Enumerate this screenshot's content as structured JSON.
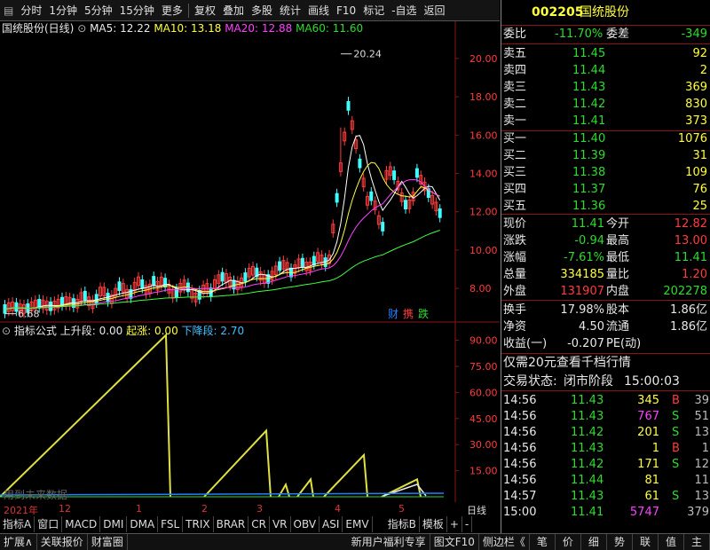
{
  "toolbar": {
    "left_items": [
      "分时",
      "1分钟",
      "5分钟",
      "15分钟",
      "更多"
    ],
    "right_items": [
      "复权",
      "叠加",
      "多股",
      "统计",
      "画线",
      "F10",
      "标记",
      "-自选",
      "返回"
    ]
  },
  "kline": {
    "title": "国统股份(日线)",
    "ma5": "MA5: 12.22",
    "ma10": "MA10: 13.18",
    "ma20": "MA20: 12.88",
    "ma60": "MA60: 11.60",
    "high_label": "20.24",
    "low_label": "6.68",
    "badges": [
      "财",
      "携",
      "跌"
    ],
    "y_ticks": [
      "20.00",
      "18.00",
      "16.00",
      "14.00",
      "12.00",
      "10.00",
      "8.00"
    ],
    "colors": {
      "ma5": "#ffffff",
      "ma10": "#ffff40",
      "ma20": "#ff40ff",
      "ma60": "#40ff40",
      "up": "#ff3c3c",
      "down": "#40ffff"
    }
  },
  "indicator": {
    "title": "指标公式",
    "up_label": "上升段: 0.00",
    "rise_label": "起涨: 0.00",
    "down_label": "下降段: 2.70",
    "future_note": "用到未来数据",
    "y_ticks": [
      "90.00",
      "75.00",
      "60.00",
      "45.00",
      "30.00",
      "15.00"
    ]
  },
  "timeline": {
    "year": "2021年",
    "months": [
      "12",
      "1",
      "2",
      "3",
      "4",
      "5"
    ],
    "right": "日线"
  },
  "tabs": [
    "指标A",
    "窗口",
    "MACD",
    "DMI",
    "DMA",
    "FSL",
    "TRIX",
    "BRAR",
    "CR",
    "VR",
    "OBV",
    "ASI",
    "EMV",
    "指标B",
    "模板",
    "+",
    "-"
  ],
  "bottom_bar": {
    "left": [
      "扩展∧",
      "关联报价",
      "财富圈"
    ],
    "middle": [
      "新用户福利专享",
      "图文F10",
      "侧边栏《"
    ],
    "right": [
      "笔",
      "价",
      "细",
      "势",
      "联",
      "值",
      "主"
    ]
  },
  "quote": {
    "code": "002205",
    "name": "国统股份",
    "weibi_label": "委比",
    "weibi": "-11.70%",
    "weicha_label": "委差",
    "weicha": "-349",
    "asks": [
      {
        "label": "卖五",
        "price": "11.45",
        "vol": "92"
      },
      {
        "label": "卖四",
        "price": "11.44",
        "vol": "2"
      },
      {
        "label": "卖三",
        "price": "11.43",
        "vol": "369"
      },
      {
        "label": "卖二",
        "price": "11.42",
        "vol": "830"
      },
      {
        "label": "卖一",
        "price": "11.41",
        "vol": "373"
      }
    ],
    "bids": [
      {
        "label": "买一",
        "price": "11.40",
        "vol": "1076"
      },
      {
        "label": "买二",
        "price": "11.39",
        "vol": "31"
      },
      {
        "label": "买三",
        "price": "11.38",
        "vol": "109"
      },
      {
        "label": "买四",
        "price": "11.37",
        "vol": "76"
      },
      {
        "label": "买五",
        "price": "11.36",
        "vol": "25"
      }
    ],
    "stats": [
      {
        "l1": "现价",
        "v1": "11.41",
        "c1": "green",
        "l2": "今开",
        "v2": "12.82",
        "c2": "red"
      },
      {
        "l1": "涨跌",
        "v1": "-0.94",
        "c1": "green",
        "l2": "最高",
        "v2": "13.00",
        "c2": "red"
      },
      {
        "l1": "涨幅",
        "v1": "-7.61%",
        "c1": "green",
        "l2": "最低",
        "v2": "11.41",
        "c2": "green"
      },
      {
        "l1": "总量",
        "v1": "334185",
        "c1": "yellow",
        "l2": "量比",
        "v2": "1.20",
        "c2": "red"
      },
      {
        "l1": "外盘",
        "v1": "131907",
        "c1": "red",
        "l2": "内盘",
        "v2": "202278",
        "c2": "green"
      }
    ],
    "stats2": [
      {
        "l1": "换手",
        "v1": "17.98%",
        "l2": "股本",
        "v2": "1.86亿"
      },
      {
        "l1": "净资",
        "v1": "4.50",
        "l2": "流通",
        "v2": "1.86亿"
      },
      {
        "l1": "收益(一)",
        "v1": "-0.207",
        "l2": "PE(动)",
        "v2": ""
      }
    ],
    "promo": "仅需20元查看千档行情",
    "trade_state_label": "交易状态:",
    "trade_state": "闭市阶段",
    "trade_time": "15:00:03",
    "ticks": [
      {
        "time": "14:56",
        "price": "11.43",
        "vol": "345",
        "side": "B",
        "n": "39",
        "vc": "yellow"
      },
      {
        "time": "14:56",
        "price": "11.43",
        "vol": "767",
        "side": "S",
        "n": "51",
        "vc": "mag"
      },
      {
        "time": "14:56",
        "price": "11.42",
        "vol": "201",
        "side": "S",
        "n": "13",
        "vc": "yellow"
      },
      {
        "time": "14:56",
        "price": "11.43",
        "vol": "1",
        "side": "B",
        "n": "1",
        "vc": "yellow"
      },
      {
        "time": "14:56",
        "price": "11.42",
        "vol": "171",
        "side": "S",
        "n": "12",
        "vc": "yellow"
      },
      {
        "time": "14:56",
        "price": "11.44",
        "vol": "81",
        "side": "",
        "n": "11",
        "vc": "yellow"
      },
      {
        "time": "14:57",
        "price": "11.43",
        "vol": "61",
        "side": "S",
        "n": "13",
        "vc": "yellow"
      },
      {
        "time": "15:00",
        "price": "11.41",
        "vol": "5747",
        "side": "",
        "n": "379",
        "vc": "mag"
      }
    ]
  }
}
